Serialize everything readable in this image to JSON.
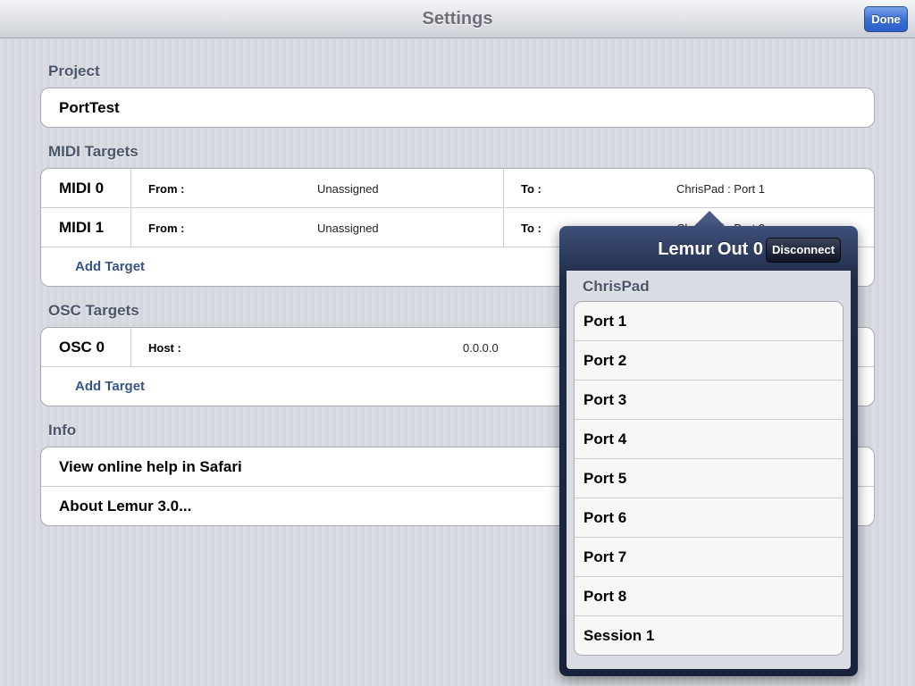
{
  "navbar": {
    "title": "Settings",
    "done_label": "Done"
  },
  "project": {
    "section_label": "Project",
    "name": "PortTest"
  },
  "midi_targets": {
    "section_label": "MIDI Targets",
    "rows": [
      {
        "name": "MIDI 0",
        "from_label": "From :",
        "from_value": "Unassigned",
        "to_label": "To :",
        "to_value": "ChrisPad : Port 1"
      },
      {
        "name": "MIDI 1",
        "from_label": "From :",
        "from_value": "Unassigned",
        "to_label": "To :",
        "to_value": "ChrisPad : Port 2"
      }
    ],
    "add_label": "Add Target"
  },
  "osc_targets": {
    "section_label": "OSC Targets",
    "rows": [
      {
        "name": "OSC 0",
        "host_label": "Host :",
        "host_value": "0.0.0.0"
      }
    ],
    "add_label": "Add Target"
  },
  "info": {
    "section_label": "Info",
    "items": [
      "View online help in Safari",
      "About Lemur 3.0..."
    ]
  },
  "popover": {
    "title": "Lemur Out 0",
    "disconnect_label": "Disconnect",
    "section_label": "ChrisPad",
    "ports": [
      "Port 1",
      "Port 2",
      "Port 3",
      "Port 4",
      "Port 5",
      "Port 6",
      "Port 7",
      "Port 8",
      "Session 1"
    ]
  }
}
